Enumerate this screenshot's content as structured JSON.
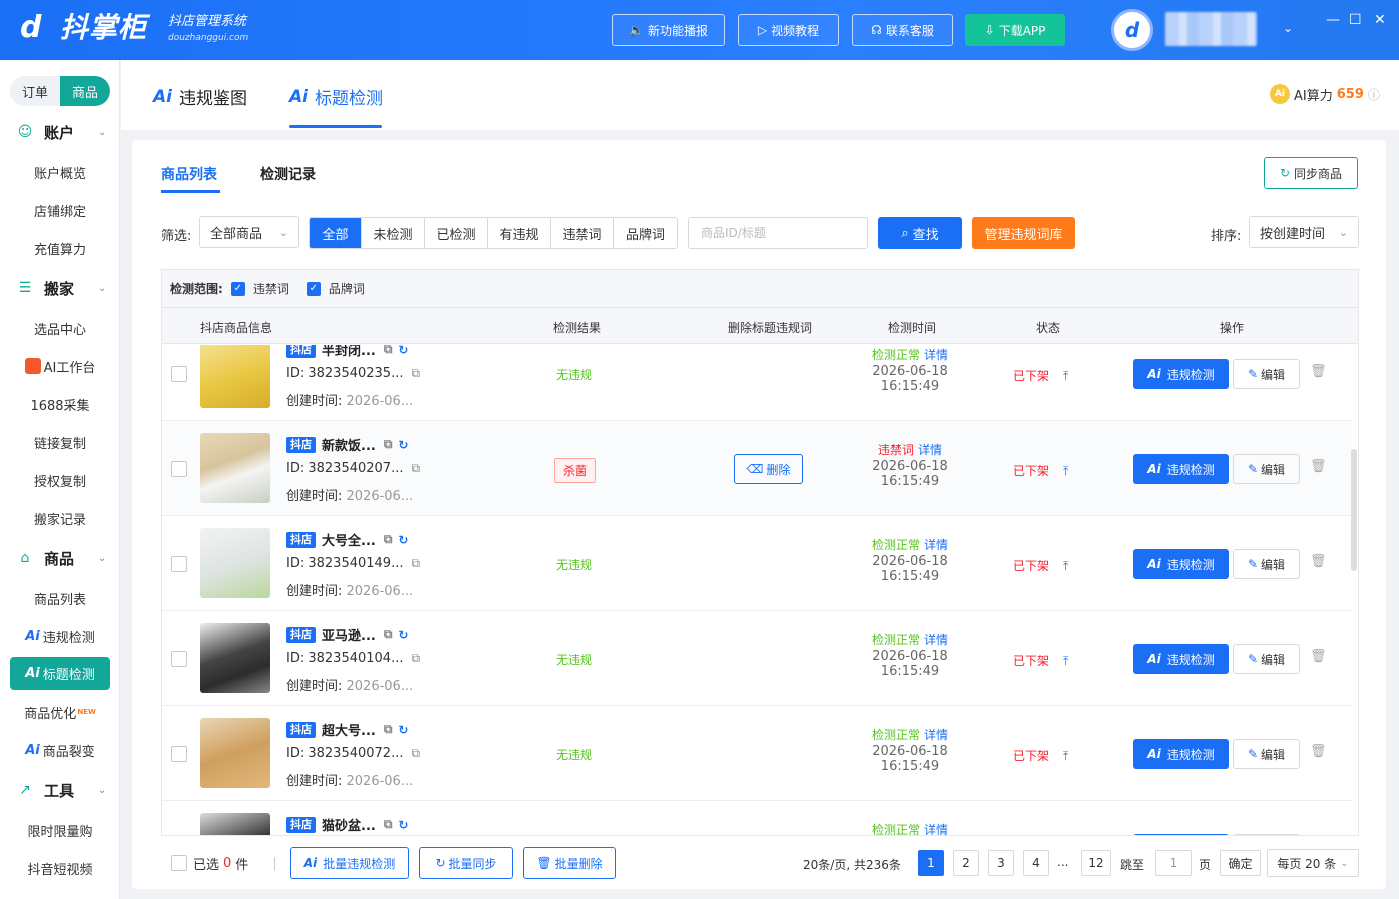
{
  "app": {
    "logo_cn": "抖掌柜",
    "logo_sub": "抖店管理系统",
    "logo_url": "douzhanggui.com"
  },
  "topbar": {
    "buttons": [
      "新功能播报",
      "视频教程",
      "联系客服",
      "下载APP"
    ]
  },
  "sidebar": {
    "switch": {
      "order": "订单",
      "goods": "商品"
    },
    "groups": [
      {
        "label": "账户",
        "items": [
          "账户概览",
          "店铺绑定",
          "充值算力"
        ]
      },
      {
        "label": "搬家",
        "items": [
          "选品中心",
          "AI工作台",
          "1688采集",
          "链接复制",
          "授权复制",
          "搬家记录"
        ]
      },
      {
        "label": "商品",
        "items": [
          "商品列表",
          "违规检测",
          "标题检测",
          "商品优化",
          "商品裂变"
        ]
      },
      {
        "label": "工具",
        "items": [
          "限时限量购",
          "抖音短视频"
        ]
      }
    ],
    "ai_badge": "Ai",
    "new_badge": "NEW"
  },
  "top_tabs": [
    "违规鉴图",
    "标题检测"
  ],
  "ai_power": {
    "label": "AI算力",
    "value": "659"
  },
  "panel": {
    "tabs": [
      "商品列表",
      "检测记录"
    ],
    "sync_label": "同步商品",
    "filter_label": "筛选:",
    "filter_select": "全部商品",
    "segments": [
      "全部",
      "未检测",
      "已检测",
      "有违规",
      "违禁词",
      "品牌词"
    ],
    "search_placeholder": "商品ID/标题",
    "search_btn": "查找",
    "manage_btn": "管理违规词库",
    "sort_label": "排序:",
    "sort_select": "按创建时间"
  },
  "table": {
    "scope_label": "检测范围:",
    "scope_opts": [
      "违禁词",
      "品牌词"
    ],
    "headers": [
      "抖店商品信息",
      "检测结果",
      "删除标题违规词",
      "检测时间",
      "状态",
      "操作"
    ],
    "shop_tag": "抖店",
    "id_prefix": "ID: ",
    "created_prefix": "创建时间: ",
    "delete_label": "删除",
    "detail_label": "详情",
    "ai_btn": "违规检测",
    "edit_btn": "编辑",
    "rows": [
      {
        "name": "半封闭...",
        "id": "3823540235...",
        "created": "2026-06...",
        "result": "无违规",
        "violation": false,
        "dstatus": "检测正常",
        "dtime": "2026-06-18 16:15:49",
        "status": "已下架"
      },
      {
        "name": "新款饭...",
        "id": "3823540207...",
        "created": "2026-06...",
        "result": "杀菌",
        "violation": true,
        "dstatus": "违禁词",
        "dtime": "2026-06-18 16:15:49",
        "status": "已下架"
      },
      {
        "name": "大号全...",
        "id": "3823540149...",
        "created": "2026-06...",
        "result": "无违规",
        "violation": false,
        "dstatus": "检测正常",
        "dtime": "2026-06-18 16:15:49",
        "status": "已下架"
      },
      {
        "name": "亚马逊...",
        "id": "3823540104...",
        "created": "2026-06...",
        "result": "无违规",
        "violation": false,
        "dstatus": "检测正常",
        "dtime": "2026-06-18 16:15:49",
        "status": "已下架"
      },
      {
        "name": "超大号...",
        "id": "3823540072...",
        "created": "2026-06...",
        "result": "无违规",
        "violation": false,
        "dstatus": "检测正常",
        "dtime": "2026-06-18 16:15:49",
        "status": "已下架"
      },
      {
        "name": "猫砂盆...",
        "id": "",
        "created": "",
        "result": "",
        "violation": false,
        "dstatus": "检测正常",
        "dtime": "",
        "status": ""
      }
    ]
  },
  "footer": {
    "selected_pre": "已选",
    "selected_count": "0",
    "selected_post": "件",
    "batch_check": "批量违规检测",
    "batch_sync": "批量同步",
    "batch_delete": "批量删除",
    "summary": "20条/页, 共236条",
    "pages": [
      "1",
      "2",
      "3",
      "4",
      "...",
      "12"
    ],
    "jump_label": "跳至",
    "jump_value": "1",
    "page_unit": "页",
    "confirm": "确定",
    "per_page": "每页 20 条"
  },
  "colors": {
    "primary": "#1a6ff5",
    "teal": "#13a79a",
    "orange": "#ff7a1a",
    "green": "#52c41a",
    "red": "#f5222d"
  }
}
